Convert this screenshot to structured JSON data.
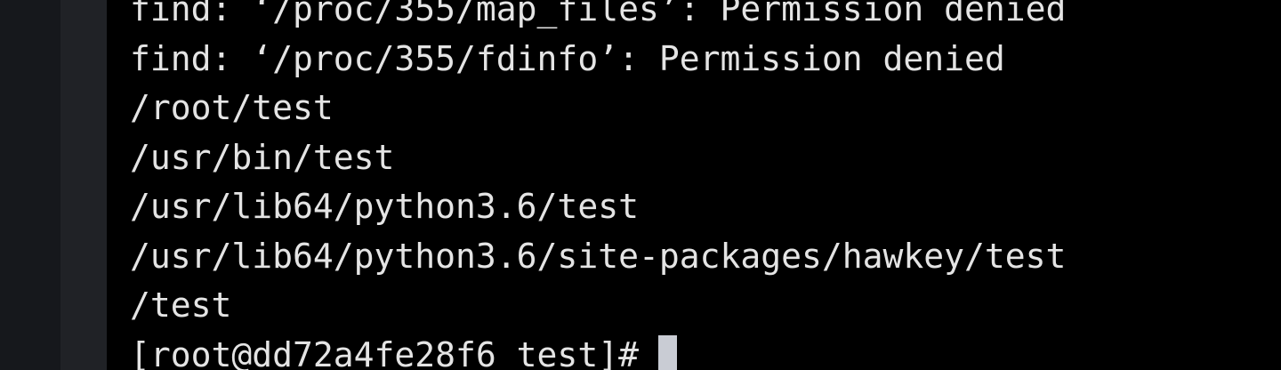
{
  "terminal": {
    "lines": [
      "find: ‘/proc/355/map_files’: Permission denied",
      "find: ‘/proc/355/fdinfo’: Permission denied",
      "/root/test",
      "/usr/bin/test",
      "/usr/lib64/python3.6/test",
      "/usr/lib64/python3.6/site-packages/hawkey/test",
      "/test"
    ],
    "prompt": "[root@dd72a4fe28f6 test]#",
    "cursor_icon": "block-cursor"
  },
  "colors": {
    "background": "#000000",
    "text": "#e4e4e4",
    "cursor": "#c9ccd4",
    "gutter_outer": "#16181c",
    "gutter_inner": "#202226"
  }
}
